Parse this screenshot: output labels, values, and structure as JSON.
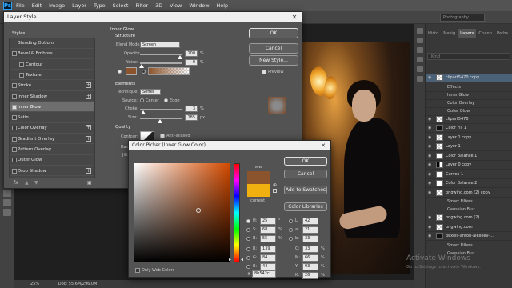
{
  "menubar": {
    "logo": "Ps",
    "items": [
      "File",
      "Edit",
      "Image",
      "Layer",
      "Type",
      "Select",
      "Filter",
      "3D",
      "View",
      "Window",
      "Help"
    ]
  },
  "workspace": "Photography",
  "status": {
    "zoom": "25%",
    "doc": "Doc: 55.6M/296.0M"
  },
  "panels": {
    "tabs": [
      "Histo",
      "Navig",
      "Layers",
      "Chann",
      "Paths"
    ],
    "active_tab": "Layers",
    "search_placeholder": "Kind",
    "layers": [
      {
        "name": "clipart5470 copy",
        "type": "checker",
        "active": true
      },
      {
        "name": "Effects",
        "type": "sub"
      },
      {
        "name": "Inner Glow",
        "type": "sub"
      },
      {
        "name": "Color Overlay",
        "type": "sub"
      },
      {
        "name": "Outer Glow",
        "type": "sub"
      },
      {
        "name": "clipart5470",
        "type": "checker"
      },
      {
        "name": "Color Fill 1",
        "type": "dark"
      },
      {
        "name": "Layer 1 copy",
        "type": "checker"
      },
      {
        "name": "Layer 1",
        "type": "checker"
      },
      {
        "name": "Color Balance 1",
        "type": "white"
      },
      {
        "name": "Layer 0 copy",
        "type": "mask"
      },
      {
        "name": "Curves 1",
        "type": "white"
      },
      {
        "name": "Color Balance 2",
        "type": "white"
      },
      {
        "name": "pngwing.com (2) copy",
        "type": "checker"
      },
      {
        "name": "Smart Filters",
        "type": "sub"
      },
      {
        "name": "Gaussian Blur",
        "type": "sub"
      },
      {
        "name": "pngwing.com (2)",
        "type": "checker"
      },
      {
        "name": "pngwing.com",
        "type": "checker"
      },
      {
        "name": "pexels-anton-alexeev-...",
        "type": "dark"
      },
      {
        "name": "Smart Filters",
        "type": "sub"
      },
      {
        "name": "Gaussian Blur",
        "type": "sub"
      }
    ]
  },
  "watermark": {
    "title": "Activate Windows",
    "subtitle": "Go to Settings to activate Windows."
  },
  "layer_style": {
    "title": "Layer Style",
    "styles_header": "Styles",
    "rows": [
      {
        "label": "Blending Options",
        "checkbox": false,
        "checked": false,
        "plus": false,
        "active": false
      },
      {
        "label": "Bevel & Emboss",
        "checkbox": true,
        "checked": false,
        "plus": false,
        "active": false
      },
      {
        "label": "Contour",
        "checkbox": true,
        "checked": false,
        "plus": false,
        "active": false,
        "indent": true
      },
      {
        "label": "Texture",
        "checkbox": true,
        "checked": false,
        "plus": false,
        "active": false,
        "indent": true
      },
      {
        "label": "Stroke",
        "checkbox": true,
        "checked": false,
        "plus": true,
        "active": false
      },
      {
        "label": "Inner Shadow",
        "checkbox": true,
        "checked": false,
        "plus": true,
        "active": false
      },
      {
        "label": "Inner Glow",
        "checkbox": true,
        "checked": true,
        "plus": false,
        "active": true
      },
      {
        "label": "Satin",
        "checkbox": true,
        "checked": false,
        "plus": false,
        "active": false
      },
      {
        "label": "Color Overlay",
        "checkbox": true,
        "checked": false,
        "plus": true,
        "active": false
      },
      {
        "label": "Gradient Overlay",
        "checkbox": true,
        "checked": false,
        "plus": true,
        "active": false
      },
      {
        "label": "Pattern Overlay",
        "checkbox": true,
        "checked": false,
        "plus": false,
        "active": false
      },
      {
        "label": "Outer Glow",
        "checkbox": true,
        "checked": false,
        "plus": false,
        "active": false
      },
      {
        "label": "Drop Shadow",
        "checkbox": true,
        "checked": false,
        "plus": true,
        "active": false
      }
    ],
    "footer_fx": "fx",
    "inner_glow": {
      "heading": "Inner Glow",
      "structure": "Structure",
      "blend_mode_label": "Blend Mode:",
      "blend_mode": "Screen",
      "opacity_label": "Opacity:",
      "opacity": "100",
      "noise_label": "Noise:",
      "noise": "0",
      "percent": "%",
      "elements": "Elements",
      "technique_label": "Technique:",
      "technique": "Softer",
      "source_label": "Source:",
      "source_center": "Center",
      "source_edge": "Edge",
      "choke_label": "Choke:",
      "choke": "3",
      "size_label": "Size:",
      "size": "185",
      "px": "px",
      "quality": "Quality",
      "contour_label": "Contour:",
      "anti_aliased": "Anti-aliased",
      "range_label": "Range:",
      "jitter_label": "Jitter:"
    },
    "buttons": {
      "ok": "OK",
      "cancel": "Cancel",
      "new_style": "New Style...",
      "preview": "Preview"
    },
    "glow_color": "#8b542c"
  },
  "color_picker": {
    "title": "Color Picker (Inner Glow Color)",
    "new_label": "new",
    "current_label": "current",
    "new_color": "#8b542c",
    "current_color": "#f0b010",
    "buttons": {
      "ok": "OK",
      "cancel": "Cancel",
      "add_swatches": "Add to Swatches",
      "color_libraries": "Color Libraries"
    },
    "only_web": "Only Web Colors",
    "hsb": [
      {
        "label": "H:",
        "value": "25",
        "unit": "°"
      },
      {
        "label": "S:",
        "value": "68",
        "unit": "%"
      },
      {
        "label": "B:",
        "value": "55",
        "unit": "%"
      }
    ],
    "rgb": [
      {
        "label": "R:",
        "value": "139"
      },
      {
        "label": "G:",
        "value": "84"
      },
      {
        "label": "B:",
        "value": "44"
      }
    ],
    "lab": [
      {
        "label": "L:",
        "value": "42"
      },
      {
        "label": "a:",
        "value": "21"
      },
      {
        "label": "b:",
        "value": "33"
      }
    ],
    "cmyk": [
      {
        "label": "C:",
        "value": "33",
        "unit": "%"
      },
      {
        "label": "M:",
        "value": "66",
        "unit": "%"
      },
      {
        "label": "Y:",
        "value": "93",
        "unit": "%"
      },
      {
        "label": "K:",
        "value": "26",
        "unit": "%"
      }
    ],
    "hex_label": "#",
    "hex": "8b542c"
  }
}
